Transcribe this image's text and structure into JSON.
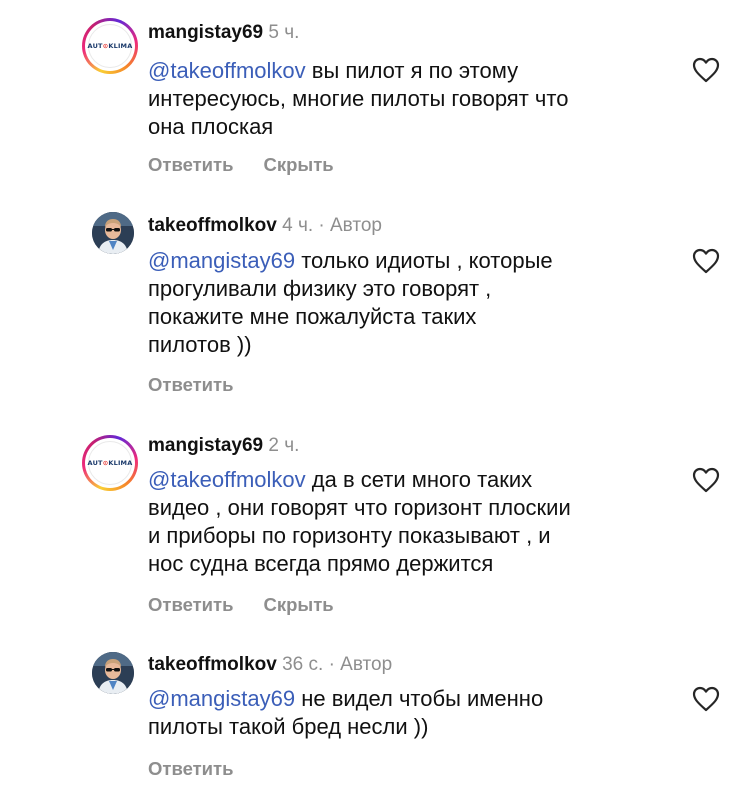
{
  "comments": [
    {
      "username": "mangistay69",
      "time": "5 ч.",
      "author_badge": "",
      "mention": "@takeoffmolkov",
      "lines": [
        " вы пилот я по этому",
        "интересуюсь, многие пилоты говорят что",
        "она плоская"
      ],
      "reply_label": "Ответить",
      "hide_label": "Скрыть",
      "avatar_icon": "autoklima-logo"
    },
    {
      "username": "takeoffmolkov",
      "time": "4 ч.",
      "author_badge": "· Автор",
      "mention": "@mangistay69",
      "lines": [
        " только идиоты , которые",
        "прогуливали физику это говорят ,",
        "покажите мне пожалуйста таких",
        "пилотов ))"
      ],
      "reply_label": "Ответить",
      "hide_label": "",
      "avatar_icon": "user-photo"
    },
    {
      "username": "mangistay69",
      "time": "2 ч.",
      "author_badge": "",
      "mention": "@takeoffmolkov",
      "lines": [
        " да в сети много таких",
        "видео , они говорят что горизонт плоскии",
        "и приборы по горизонту показывают , и",
        "нос судна всегда прямо держится"
      ],
      "reply_label": "Ответить",
      "hide_label": "Скрыть",
      "avatar_icon": "autoklima-logo"
    },
    {
      "username": "takeoffmolkov",
      "time": "36 с.",
      "author_badge": "· Автор",
      "mention": "@mangistay69",
      "lines": [
        " не видел чтобы именно",
        "пилоты такой бред несли ))"
      ],
      "reply_label": "Ответить",
      "hide_label": "",
      "avatar_icon": "user-photo"
    }
  ],
  "logo": {
    "part1": "AUT",
    "part2": "⊙",
    "part3": "KLIMA"
  },
  "colors": {
    "mention": "#3b5eb8",
    "meta": "#8e8e8e",
    "text": "#111111"
  }
}
